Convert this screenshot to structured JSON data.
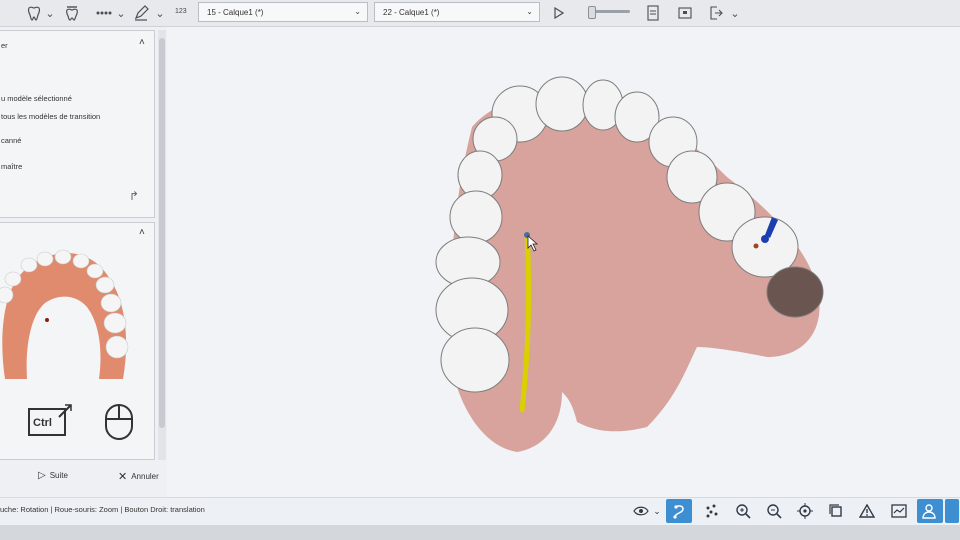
{
  "toolbar": {
    "icons": [
      "tooth-icon",
      "tooth-grind-icon",
      "dots-icon",
      "pencil-icon",
      "play-icon",
      "export-icon",
      "image-icon",
      "exit-icon"
    ],
    "num_label": "123",
    "layer_start": "15 - Calque1 (*)",
    "layer_end": "22 - Calque1 (*)",
    "chev": "⌄"
  },
  "left_panel": {
    "collapse_glyph": "˄",
    "header_fragment": "er",
    "option_selected_model": "u modèle sélectionné",
    "option_transition_models": "tous les modèles de transition",
    "option_scanned": "canné",
    "option_master": "maître",
    "redo_glyph": "↱"
  },
  "actions": {
    "ctrl_label": "Ctrl",
    "next_label": "Suite",
    "cancel_label": "Annuler"
  },
  "status": {
    "hint": "uche: Rotation | Roue-souris: Zoom | Bouton Droit: translation"
  },
  "colors": {
    "accent": "#3e8fd1",
    "gum": "#d7a39c",
    "tooth": "#f2f2f2",
    "marker_yellow": "#d9d000",
    "marker_blue": "#1c3fb0"
  }
}
